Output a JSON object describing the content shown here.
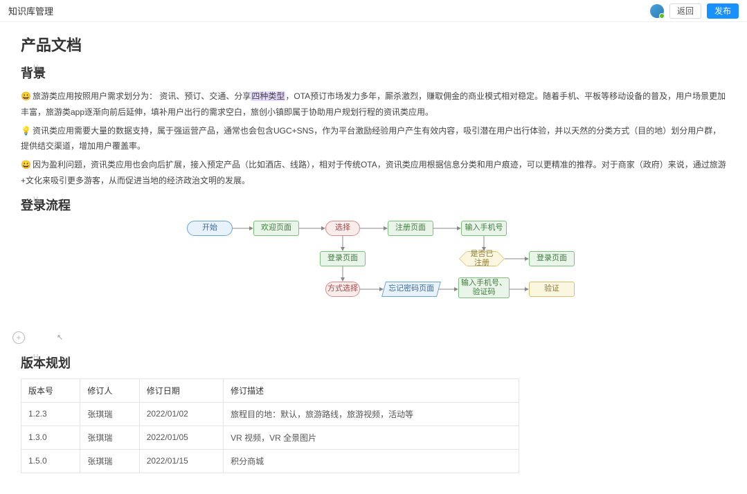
{
  "header": {
    "title": "知识库管理",
    "back": "返回",
    "publish": "发布"
  },
  "doc": {
    "title": "产品文档",
    "sections": {
      "background": {
        "heading": "背景",
        "p1_prefix": "旅游类应用按照用户需求划分为",
        "p1_colon": "：",
        "p1_types": "资讯、预订、交通、分享",
        "p1_highlight": "四种类型",
        "p1_rest": "，OTA预订市场发力多年，厮杀激烈，赚取佣金的商业模式相对稳定。随着手机、平板等移动设备的普及，用户场景更加丰富，旅游类app逐渐向前后延伸，填补用户出行的需求空白，旅创小镇即属于协助用户规划行程的资讯类应用。",
        "p2": "资讯类应用需要大量的数据支持，属于强运营产品，通常也会包含UGC+SNS，作为平台激励经验用户产生有效内容，吸引潜在用户出行体验，并以天然的分类方式（目的地）划分用户群，提供结交渠道，增加用户覆盖率。",
        "p3": "因为盈利问题，资讯类应用也会向后扩展，接入预定产品（比如酒店、线路），相对于传统OTA，资讯类应用根据信息分类和用户痕迹，可以更精准的推荐。对于商家（政府）来说，通过旅游+文化来吸引更多游客，从而促进当地的经济政治文明的发展。"
      },
      "login_flow": {
        "heading": "登录流程",
        "nodes": {
          "start": "开始",
          "welcome": "欢迎页面",
          "choose": "选择",
          "register": "注册页面",
          "phone": "输入手机号",
          "login": "登录页面",
          "registered": "是否已注册",
          "login2": "登录页面",
          "method": "方式选择",
          "forgot": "忘记密码页面",
          "phone_code": "输入手机号、验证码",
          "verify": "验证"
        }
      },
      "versions": {
        "heading": "版本规划",
        "columns": [
          "版本号",
          "修订人",
          "修订日期",
          "修订描述"
        ],
        "rows": [
          {
            "ver": "1.2.3",
            "author": "张琪瑞",
            "date": "2022/01/02",
            "desc": "旅程目的地：默认，旅游路线，旅游视频，活动等"
          },
          {
            "ver": "1.3.0",
            "author": "张琪瑞",
            "date": "2022/01/05",
            "desc": "VR 视频，VR 全景图片"
          },
          {
            "ver": "1.5.0",
            "author": "张琪瑞",
            "date": "2022/01/15",
            "desc": "积分商城"
          }
        ]
      }
    }
  }
}
